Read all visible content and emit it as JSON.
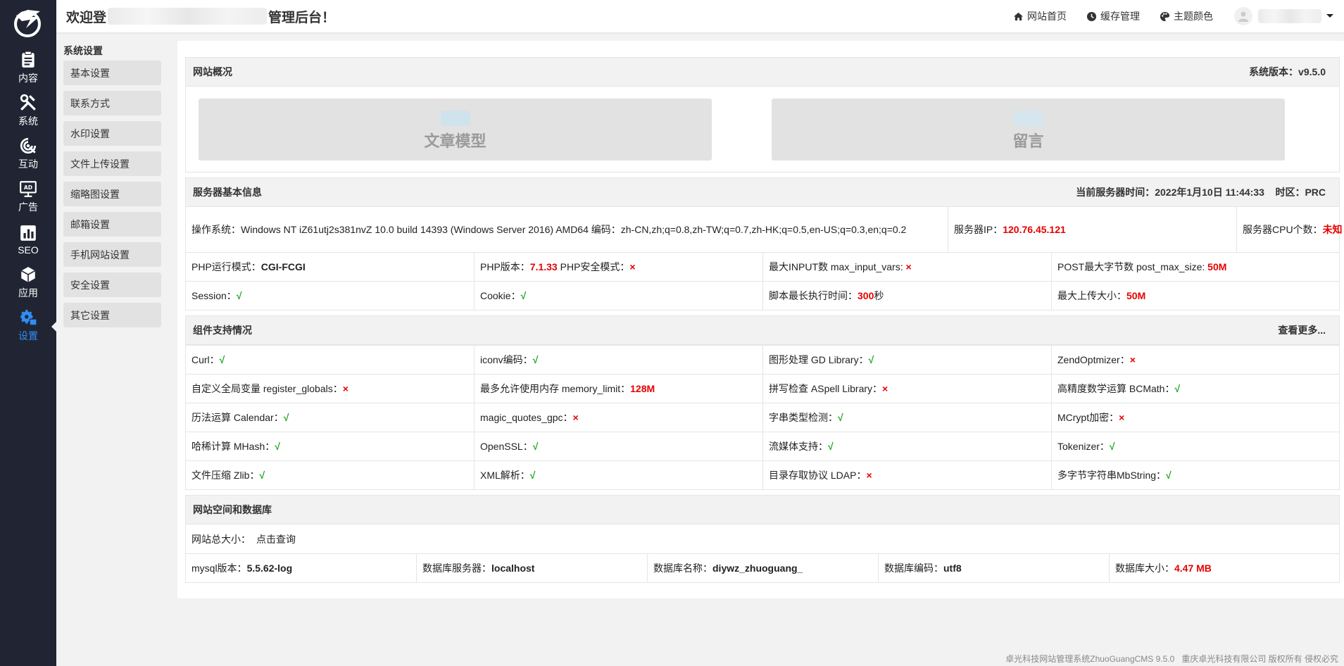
{
  "rail": {
    "items": [
      {
        "label": "内容",
        "icon": "clipboard-icon"
      },
      {
        "label": "系统",
        "icon": "tools-icon"
      },
      {
        "label": "互动",
        "icon": "interaction-icon"
      },
      {
        "label": "广告",
        "icon": "ad-icon"
      },
      {
        "label": "SEO",
        "icon": "chart-icon"
      },
      {
        "label": "应用",
        "icon": "cube-icon"
      },
      {
        "label": "设置",
        "icon": "gear-icon"
      }
    ],
    "active_color": "#2f8ef4",
    "background": "#212533"
  },
  "topbar": {
    "welcome_prefix": "欢迎登",
    "welcome_suffix": "管理后台！",
    "nav": [
      {
        "label": "网站首页",
        "icon": "home-icon"
      },
      {
        "label": "缓存管理",
        "icon": "clock-icon"
      },
      {
        "label": "主题颜色",
        "icon": "palette-icon"
      }
    ]
  },
  "submenu": {
    "title": "系统设置",
    "items": [
      "基本设置",
      "联系方式",
      "水印设置",
      "文件上传设置",
      "缩略图设置",
      "邮箱设置",
      "手机网站设置",
      "安全设置",
      "其它设置"
    ]
  },
  "overview": {
    "title": "网站概况",
    "version": "系统版本：v9.5.0",
    "models": [
      "文章模型",
      "留言"
    ]
  },
  "server": {
    "title": "服务器基本信息",
    "time": "当前服务器时间：2022年1月10日 11:44:33    时区：PRC",
    "os_label": "操作系统：",
    "os_value": "Windows NT iZ61utj2s381nvZ 10.0 build 14393 (Windows Server 2016) AMD64 编码：zh-CN,zh;q=0.8,zh-TW;q=0.7,zh-HK;q=0.5,en-US;q=0.3,en;q=0.2",
    "ip_label": "服务器IP：",
    "ip_value": "120.76.45.121",
    "cpu_label": "服务器CPU个数：",
    "cpu_value": "未知",
    "php_mode_label": "PHP运行模式：",
    "php_mode_value": "CGI-FCGI",
    "php_ver_label": "PHP版本：",
    "php_ver_value": "7.1.33",
    "php_safe_label": " PHP安全模式：",
    "php_safe_value": "×",
    "max_input_label": "最大INPUT数 max_input_vars: ",
    "max_input_value": "×",
    "post_max_label": "POST最大字节数 post_max_size: ",
    "post_max_value": "50M",
    "session_label": "Session：",
    "session_value": "√",
    "cookie_label": "Cookie：",
    "cookie_value": "√",
    "exec_label": "脚本最长执行时间：",
    "exec_value": "300",
    "exec_unit": "秒",
    "upload_label": "最大上传大小：",
    "upload_value": "50M"
  },
  "components": {
    "title": "组件支持情况",
    "more": "查看更多...",
    "rows": [
      [
        {
          "label": "Curl：",
          "value": "√",
          "ok": true
        },
        {
          "label": "iconv编码：",
          "value": "√",
          "ok": true
        },
        {
          "label": "图形处理 GD Library：",
          "value": "√",
          "ok": true
        },
        {
          "label": "ZendOptmizer：",
          "value": "×",
          "ok": false
        }
      ],
      [
        {
          "label": "自定义全局变量 register_globals：",
          "value": "×",
          "ok": false
        },
        {
          "label": "最多允许使用内存 memory_limit：",
          "value": "128M",
          "ok": false
        },
        {
          "label": "拼写检查 ASpell Library：",
          "value": "×",
          "ok": false
        },
        {
          "label": "高精度数学运算 BCMath：",
          "value": "√",
          "ok": true
        }
      ],
      [
        {
          "label": "历法运算 Calendar：",
          "value": "√",
          "ok": true
        },
        {
          "label": "magic_quotes_gpc：",
          "value": "×",
          "ok": false
        },
        {
          "label": "字串类型检测：",
          "value": "√",
          "ok": true
        },
        {
          "label": "MCrypt加密：",
          "value": "×",
          "ok": false
        }
      ],
      [
        {
          "label": "哈稀计算 MHash：",
          "value": "√",
          "ok": true
        },
        {
          "label": "OpenSSL：",
          "value": "√",
          "ok": true
        },
        {
          "label": "流媒体支持：",
          "value": "√",
          "ok": true
        },
        {
          "label": "Tokenizer：",
          "value": "√",
          "ok": true
        }
      ],
      [
        {
          "label": "文件压缩 Zlib：",
          "value": "√",
          "ok": true
        },
        {
          "label": "XML解析：",
          "value": "√",
          "ok": true
        },
        {
          "label": "目录存取协议 LDAP：",
          "value": "×",
          "ok": false
        },
        {
          "label": "多字节字符串MbString：",
          "value": "√",
          "ok": true
        }
      ]
    ]
  },
  "db": {
    "title": "网站空间和数据库",
    "size_label": "网站总大小：",
    "size_link": "点击查询",
    "mysql_label": "mysql版本：",
    "mysql_value": "5.5.62-log",
    "server_label": "数据库服务器：",
    "server_value": "localhost",
    "name_label": "数据库名称：",
    "name_value": "diywz_zhuoguang_",
    "charset_label": "数据库编码：",
    "charset_value": "utf8",
    "dbsize_label": "数据库大小：",
    "dbsize_value": "4.47 MB"
  },
  "footer": "卓光科技网站管理系统ZhuoGuangCMS 9.5.0   重庆卓光科技有限公司 版权所有 侵权必究"
}
